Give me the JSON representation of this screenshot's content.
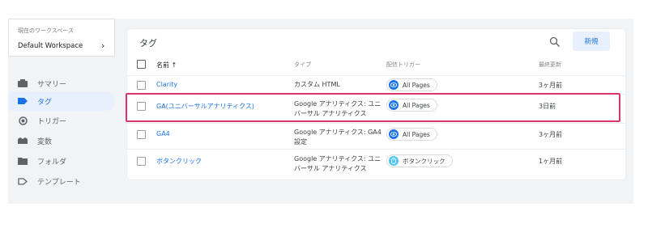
{
  "workspace": {
    "caption": "現在のワークスペース",
    "name": "Default Workspace"
  },
  "sidebar": {
    "items": [
      {
        "label": "サマリー",
        "icon": "summary-icon",
        "active": false
      },
      {
        "label": "タグ",
        "icon": "tag-icon",
        "active": true
      },
      {
        "label": "トリガー",
        "icon": "trigger-icon",
        "active": false
      },
      {
        "label": "変数",
        "icon": "variables-icon",
        "active": false
      },
      {
        "label": "フォルダ",
        "icon": "folder-icon",
        "active": false
      },
      {
        "label": "テンプレート",
        "icon": "template-icon",
        "active": false
      }
    ]
  },
  "main": {
    "title": "タグ",
    "new_button": "新規",
    "columns": {
      "name": "名前 ↑",
      "type": "タイプ",
      "trigger": "配信トリガー",
      "updated": "最終更新"
    },
    "rows": [
      {
        "name": "Clarity",
        "type": "カスタム HTML",
        "trigger": "All Pages",
        "updated": "3ヶ月前"
      },
      {
        "name": "GA(ユニバーサルアナリティクス)",
        "type": "Google アナリティクス: ユニバーサル アナリティクス",
        "trigger": "All Pages",
        "updated": "3日前"
      },
      {
        "name": "GA4",
        "type": "Google アナリティクス: GA4 設定",
        "trigger": "All Pages",
        "updated": "3ヶ月前"
      },
      {
        "name": "ボタンクリック",
        "type": "Google アナリティクス: ユニバーサル アナリティクス",
        "trigger": "ボタンクリック",
        "updated": "1ヶ月前"
      }
    ]
  },
  "colors": {
    "accent": "#1a73e8",
    "highlight": "#d8356e",
    "active_bg": "#e8f0fe"
  }
}
